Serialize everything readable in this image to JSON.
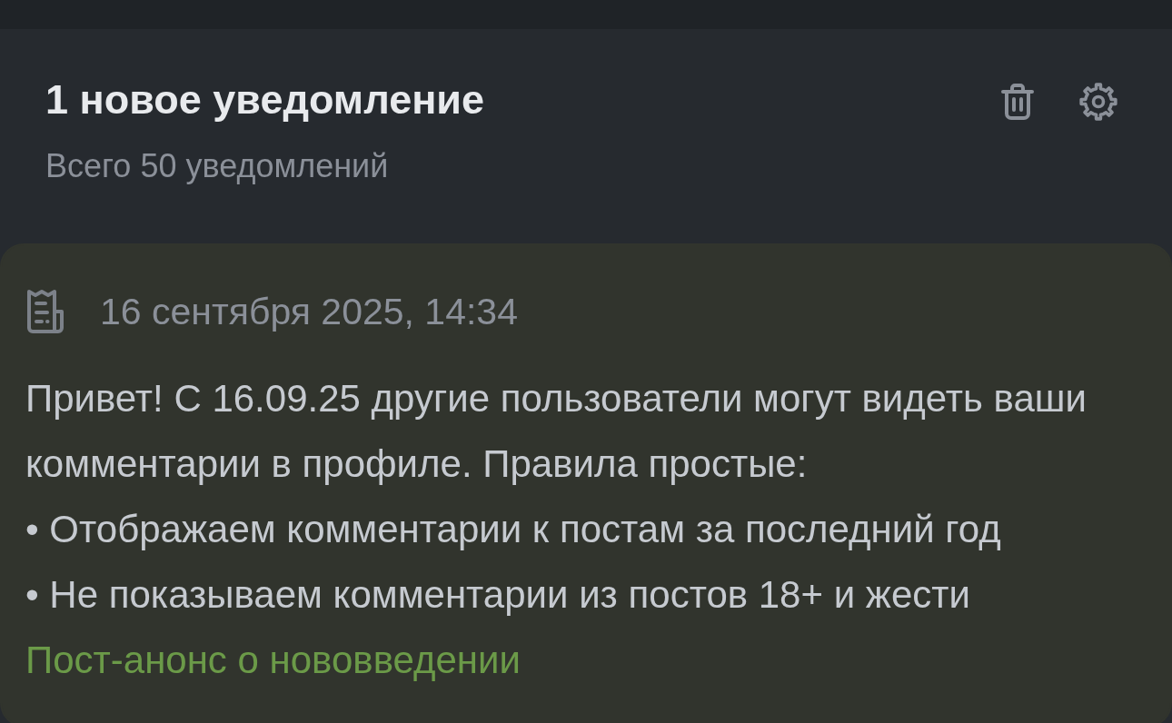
{
  "header": {
    "title": "1 новое уведомление",
    "subtitle": "Всего 50 уведомлений"
  },
  "notifications": [
    {
      "unread": true,
      "date": "16 сентября 2025, 14:34",
      "intro": "Привет! С 16.09.25 другие пользователи могут видеть ваши комментарии в профиле. Правила простые:",
      "bullets": [
        "• Отображаем комментарии к постам за последний год",
        "• Не показываем комментарии из постов 18+ и жести"
      ],
      "link": "Пост-анонс о нововведении"
    }
  ]
}
